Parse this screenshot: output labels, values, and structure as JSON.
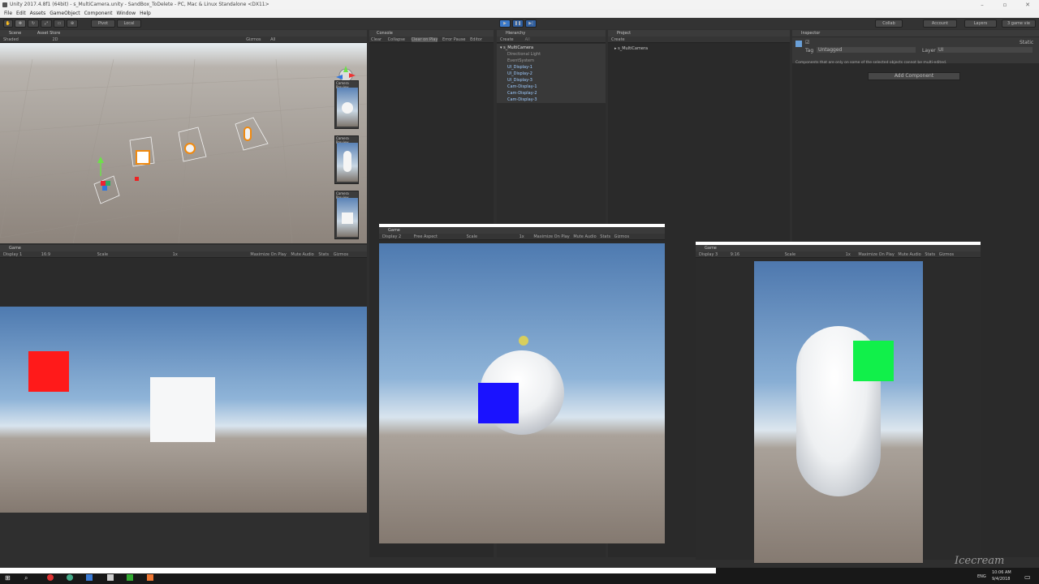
{
  "window": {
    "title": "Unity 2017.4.8f1 (64bit) - s_MultiCamera.unity - SandBox_ToDelete - PC, Mac & Linux Standalone <DX11>"
  },
  "menu": [
    "File",
    "Edit",
    "Assets",
    "GameObject",
    "Component",
    "Window",
    "Help"
  ],
  "toolbar": {
    "pivot": "Pivot",
    "local": "Local",
    "collab": "Collab",
    "account": "Account",
    "layers": "Layers",
    "layout": "3 game vie"
  },
  "scene_panel": {
    "tabs": [
      "Scene",
      "Asset Store"
    ],
    "shading": "Shaded",
    "mode_2d": "2D",
    "gizmos": "Gizmos",
    "search": "All",
    "camera_preview_label": "Camera Preview"
  },
  "console": {
    "tab": "Console",
    "buttons": [
      "Clear",
      "Collapse",
      "Clear on Play",
      "Error Pause",
      "Editor"
    ]
  },
  "hierarchy": {
    "tab": "Hierarchy",
    "create": "Create",
    "search": "All",
    "scene": "s_MultiCamera",
    "items": [
      "Directional Light",
      "EventSystem",
      "UI_Display-1",
      "UI_Display-2",
      "UI_Display-3",
      "Cam-Display-1",
      "Cam-Display-2",
      "Cam-Display-3"
    ]
  },
  "project": {
    "tab": "Project",
    "create": "Create",
    "item": "s_MultiCamera"
  },
  "inspector": {
    "tab": "Inspector",
    "static": "Static",
    "tag_label": "Tag",
    "tag_value": "Untagged",
    "layer_label": "Layer",
    "layer_value": "UI",
    "notice": "Components that are only on some of the selected objects cannot be multi-edited.",
    "add_component": "Add Component"
  },
  "game1": {
    "tab": "Game",
    "display": "Display 1",
    "aspect": "16:9",
    "scale_label": "Scale",
    "scale_value": "1x",
    "maximize": "Maximize On Play",
    "mute": "Mute Audio",
    "stats": "Stats",
    "gizmos": "Gizmos"
  },
  "game2": {
    "tab": "Game",
    "display": "Display 2",
    "aspect": "Free Aspect",
    "scale_label": "Scale",
    "scale_value": "1x",
    "maximize": "Maximize On Play",
    "mute": "Mute Audio",
    "stats": "Stats",
    "gizmos": "Gizmos"
  },
  "game3": {
    "tab": "Game",
    "display": "Display 3",
    "aspect": "9:16",
    "scale_label": "Scale",
    "scale_value": "1x",
    "maximize": "Maximize On Play",
    "mute": "Mute Audio",
    "stats": "Stats",
    "gizmos": "Gizmos"
  },
  "taskbar": {
    "lang": "ENG",
    "time": "10:06 AM",
    "date": "9/4/2018",
    "watermark": "Icecream"
  },
  "colors": {
    "red_square": "#ff1a1a",
    "blue_square": "#1a12ff",
    "green_square": "#11f04a",
    "play_blue": "#3a78c8"
  }
}
